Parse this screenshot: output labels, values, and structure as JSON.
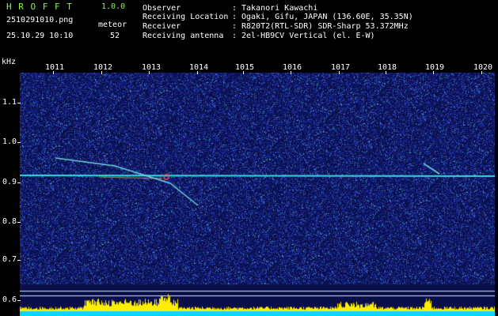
{
  "header": {
    "app_title": "H R O F F T",
    "version": "1.0.0",
    "filename": "2510291010.png",
    "datetime": "25.10.29 10:10",
    "meteor_label": "meteor",
    "meteor_count": "52",
    "info": [
      {
        "label": "Observer",
        "sep": ":",
        "value": "Takanori Kawachi"
      },
      {
        "label": "Receiving Location",
        "sep": ":",
        "value": "Ogaki, Gifu, JAPAN (136.60E, 35.35N)"
      },
      {
        "label": "Receiver",
        "sep": ":",
        "value": "R820T2(RTL-SDR) SDR-Sharp 53.372MHz"
      },
      {
        "label": "Receiving antenna",
        "sep": ":",
        "value": "2el-HB9CV Vertical (el. E-W)"
      }
    ]
  },
  "axes": {
    "y_unit": "kHz",
    "x_ticks": [
      "1011",
      "1012",
      "1013",
      "1014",
      "1015",
      "1016",
      "1017",
      "1018",
      "1019",
      "1020"
    ],
    "y_ticks": [
      "1.1",
      "1.0",
      "0.9",
      "0.8",
      "0.7",
      "0.6"
    ]
  },
  "colors": {
    "background": "#000000",
    "noise": "#1c2a8c",
    "title_green": "#7dff3c",
    "trace_cyan": "#35e0e0",
    "histogram_yellow": "#ffee00",
    "baseline_cyan": "#00d8ff"
  }
}
